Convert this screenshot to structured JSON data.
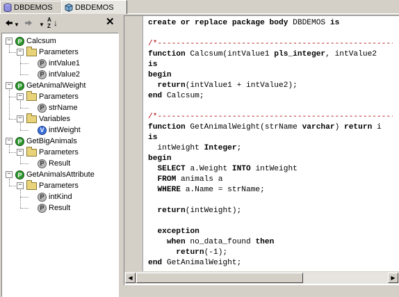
{
  "tabs": [
    {
      "label": "DBDEMOS",
      "icon": "database-icon",
      "active": false
    },
    {
      "label": "DBDEMOS",
      "icon": "package-icon",
      "active": true
    }
  ],
  "toolbar": {
    "back_icon": "arrow-left-icon",
    "forward_icon": "arrow-right-icon",
    "sort_icon": "sort-az-icon",
    "sort_label": "AZ",
    "close_icon": "close-icon"
  },
  "tree": {
    "nodes": [
      {
        "label": "Calcsum",
        "kind": "function",
        "icon": "function-icon",
        "icon_text": "P"
      },
      {
        "label": "Parameters",
        "kind": "folder",
        "icon": "folder-icon"
      },
      {
        "label": "intValue1",
        "kind": "param",
        "icon": "parameter-icon",
        "icon_text": "P"
      },
      {
        "label": "intValue2",
        "kind": "param",
        "icon": "parameter-icon",
        "icon_text": "P"
      },
      {
        "label": "GetAnimalWeight",
        "kind": "function",
        "icon": "function-icon",
        "icon_text": "P"
      },
      {
        "label": "Parameters",
        "kind": "folder",
        "icon": "folder-icon"
      },
      {
        "label": "strName",
        "kind": "param",
        "icon": "parameter-icon",
        "icon_text": "P"
      },
      {
        "label": "Variables",
        "kind": "folder",
        "icon": "folder-icon"
      },
      {
        "label": "intWeight",
        "kind": "variable",
        "icon": "variable-icon",
        "icon_text": "V"
      },
      {
        "label": "GetBigAnimals",
        "kind": "function",
        "icon": "function-icon",
        "icon_text": "P"
      },
      {
        "label": "Parameters",
        "kind": "folder",
        "icon": "folder-icon"
      },
      {
        "label": "Result",
        "kind": "param",
        "icon": "parameter-icon",
        "icon_text": "P"
      },
      {
        "label": "GetAnimalsAttribute",
        "kind": "function",
        "icon": "function-icon",
        "icon_text": "P"
      },
      {
        "label": "Parameters",
        "kind": "folder",
        "icon": "folder-icon"
      },
      {
        "label": "intKind",
        "kind": "param",
        "icon": "parameter-icon",
        "icon_text": "P"
      },
      {
        "label": "Result",
        "kind": "param",
        "icon": "parameter-icon",
        "icon_text": "P"
      }
    ]
  },
  "editor": {
    "colors": {
      "keyword": "#000000",
      "comment": "#b00000"
    },
    "lines": [
      [
        {
          "t": "create or replace package body",
          "k": true
        },
        {
          "t": " DBDEMOS "
        },
        {
          "t": "is",
          "k": true
        }
      ],
      [],
      [
        {
          "t": "/*------------------------------------------------------------",
          "c": true
        }
      ],
      [
        {
          "t": "function",
          "k": true
        },
        {
          "t": " Calcsum(intValue1 "
        },
        {
          "t": "pls_integer",
          "k": true
        },
        {
          "t": ", intValue2"
        }
      ],
      [
        {
          "t": "is",
          "k": true
        }
      ],
      [
        {
          "t": "begin",
          "k": true
        }
      ],
      [
        {
          "t": "  "
        },
        {
          "t": "return",
          "k": true
        },
        {
          "t": "(intValue1 + intValue2);"
        }
      ],
      [
        {
          "t": "end",
          "k": true
        },
        {
          "t": " Calcsum;"
        }
      ],
      [],
      [
        {
          "t": "/*------------------------------------------------------------",
          "c": true
        }
      ],
      [
        {
          "t": "function",
          "k": true
        },
        {
          "t": " GetAnimalWeight(strName "
        },
        {
          "t": "varchar",
          "k": true
        },
        {
          "t": ") "
        },
        {
          "t": "return",
          "k": true
        },
        {
          "t": " i"
        }
      ],
      [
        {
          "t": "is",
          "k": true
        }
      ],
      [
        {
          "t": "  intWeight "
        },
        {
          "t": "Integer",
          "k": true
        },
        {
          "t": ";"
        }
      ],
      [
        {
          "t": "begin",
          "k": true
        }
      ],
      [
        {
          "t": "  "
        },
        {
          "t": "SELECT",
          "k": true
        },
        {
          "t": " a.Weight "
        },
        {
          "t": "INTO",
          "k": true
        },
        {
          "t": " intWeight"
        }
      ],
      [
        {
          "t": "  "
        },
        {
          "t": "FROM",
          "k": true
        },
        {
          "t": " animals a"
        }
      ],
      [
        {
          "t": "  "
        },
        {
          "t": "WHERE",
          "k": true
        },
        {
          "t": " a.Name = strName;"
        }
      ],
      [],
      [
        {
          "t": "  "
        },
        {
          "t": "return",
          "k": true
        },
        {
          "t": "(intWeight);"
        }
      ],
      [],
      [
        {
          "t": "  "
        },
        {
          "t": "exception",
          "k": true
        }
      ],
      [
        {
          "t": "    "
        },
        {
          "t": "when",
          "k": true
        },
        {
          "t": " no_data_found "
        },
        {
          "t": "then",
          "k": true
        }
      ],
      [
        {
          "t": "      "
        },
        {
          "t": "return",
          "k": true
        },
        {
          "t": "(-1);"
        }
      ],
      [
        {
          "t": "end",
          "k": true
        },
        {
          "t": " GetAnimalWeight;"
        }
      ]
    ]
  },
  "scrollbar": {
    "left_icon": "scroll-left-icon",
    "right_icon": "scroll-right-icon"
  }
}
